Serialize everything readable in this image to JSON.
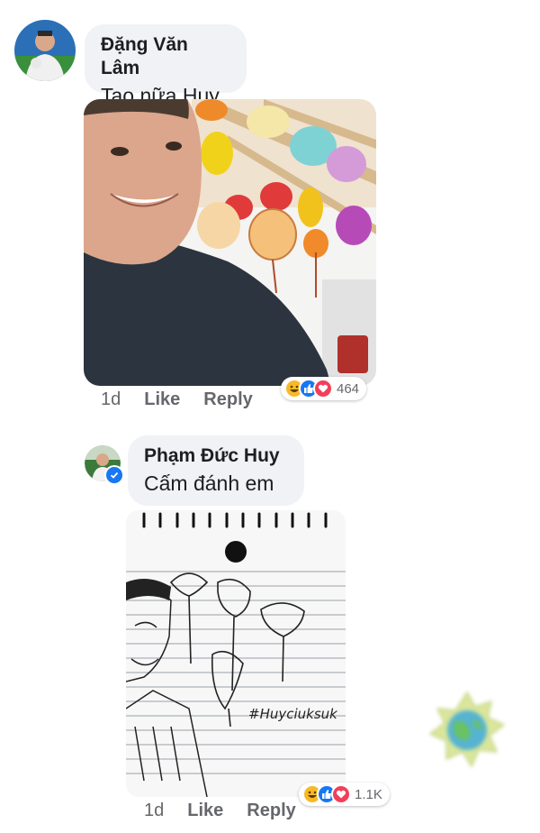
{
  "comment1": {
    "author": "Đặng Văn Lâm",
    "text": "Tao nữa Huy",
    "time": "1d",
    "like_label": "Like",
    "reply_label": "Reply",
    "reaction_count": "464",
    "reactions": [
      "haha-icon",
      "like-icon",
      "love-icon"
    ]
  },
  "comment2": {
    "author": "Phạm Đức Huy",
    "text": "Cấm đánh em",
    "time": "1d",
    "like_label": "Like",
    "reply_label": "Reply",
    "reaction_count": "1.1K",
    "reactions": [
      "haha-icon",
      "like-icon",
      "love-icon"
    ],
    "sketch_caption": "#Huyciuksuk"
  },
  "colors": {
    "bubble": "#f0f2f5",
    "like_blue": "#1877f2",
    "love_red": "#f33e58",
    "haha_yellow": "#f7b928",
    "meta_grey": "#65676b"
  }
}
